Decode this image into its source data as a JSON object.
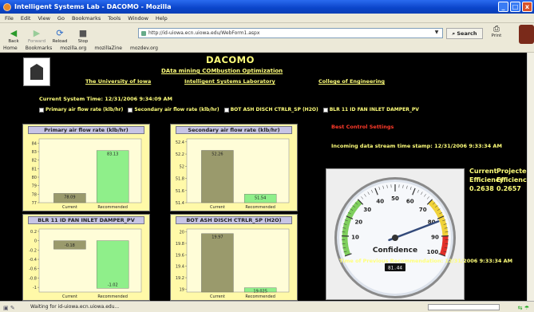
{
  "window": {
    "title": "Intelligent Systems Lab - DACOMO - Mozilla",
    "min": "_",
    "max": "□",
    "close": "x"
  },
  "menu": [
    "File",
    "Edit",
    "View",
    "Go",
    "Bookmarks",
    "Tools",
    "Window",
    "Help"
  ],
  "nav": {
    "back": "Back",
    "forward": "Forward",
    "reload": "Reload",
    "stop": "Stop",
    "url": "http://id-uiowa.ecn.uiowa.edu/WebForm1.aspx",
    "search": "Search",
    "print": "Print"
  },
  "bookmarks": [
    "Home",
    "Bookmarks",
    "mozilla.org",
    "mozillaZine",
    "mozdev.org"
  ],
  "page": {
    "title": "DACOMO",
    "subtitle": "DAta mining COMbustion Optimization",
    "links": [
      "The University of Iowa",
      "Intelligent Systems Laboratory",
      "College of Engineering"
    ],
    "system_time": "Current System Time: 12/31/2006 9:34:09 AM",
    "checkboxes": [
      "Primary air flow rate (klb/hr)",
      "Secondary air flow rate (klb/hr)",
      "BOT ASH DISCH CTRLR_SP (H2O)",
      "BLR 11 ID FAN INLET DAMPER_PV"
    ],
    "best_control": "Best Control Settings",
    "stream_time": "Incoming data stream time stamp: 12/31/2006 9:33:34 AM",
    "prev_rec": "Time of Previous Recommendation: 12/31/2006 9:33:34 AM",
    "efficiency": {
      "headers": [
        "Current",
        "Projected"
      ],
      "headers2": [
        "Efficiency",
        "Efficiency"
      ],
      "values": [
        "0.2638",
        "0.2657"
      ]
    },
    "gauge": {
      "label": "Confidence",
      "value": "81.44",
      "ticks": [
        "10",
        "20",
        "30",
        "40",
        "50",
        "60",
        "70",
        "80",
        "90",
        "100"
      ],
      "level": 81.44
    }
  },
  "panels": [
    {
      "title": "Primary air flow rate (klb/hr)",
      "ticks": [
        "84",
        "83",
        "82",
        "81",
        "80",
        "79",
        "78",
        "77"
      ],
      "ymin": 77,
      "ymax": 84.5,
      "current": 78.09,
      "recommended": 83.13,
      "current_label": "78.09",
      "recommended_label": "83.13",
      "cats": [
        "Current",
        "Recommended"
      ]
    },
    {
      "title": "Secondary air flow rate (klb/hr)",
      "ticks": [
        "52.4",
        "52.2",
        "52",
        "51.8",
        "51.6",
        "51.4"
      ],
      "ymin": 51.4,
      "ymax": 52.45,
      "current": 52.26,
      "recommended": 51.54,
      "current_label": "52.26",
      "recommended_label": "51.54",
      "cats": [
        "Current",
        "Recommended"
      ]
    },
    {
      "title": "BLR 11 ID FAN INLET   DAMPER_PV",
      "ticks": [
        "0.2",
        "0",
        "-0.2",
        "-0.4",
        "-0.6",
        "-0.8",
        "-1"
      ],
      "ymin": -1.1,
      "ymax": 0.25,
      "current": -0.18,
      "recommended": -1.02,
      "current_label": "-0.18",
      "recommended_label": "-1.02",
      "cats": [
        "Current",
        "Recommended"
      ]
    },
    {
      "title": "BOT ASH DISCH CTRLR_SP (H2O)",
      "ticks": [
        "20",
        "19.8",
        "19.6",
        "19.4",
        "19.2",
        "19"
      ],
      "ymin": 18.95,
      "ymax": 20.05,
      "current": 19.97,
      "recommended": 19.025,
      "current_label": "19.97",
      "recommended_label": "19.025",
      "cats": [
        "Current",
        "Recommended"
      ]
    }
  ],
  "status": {
    "text": "Waiting for id-uiowa.ecn.uiowa.edu..."
  },
  "colors": {
    "current_bar": "#9a9a6c",
    "recommended_bar": "#8fef8a",
    "panel_bg": "#fff9a8",
    "page_text": "#ffff7a",
    "highlight": "#ff3a2a"
  }
}
